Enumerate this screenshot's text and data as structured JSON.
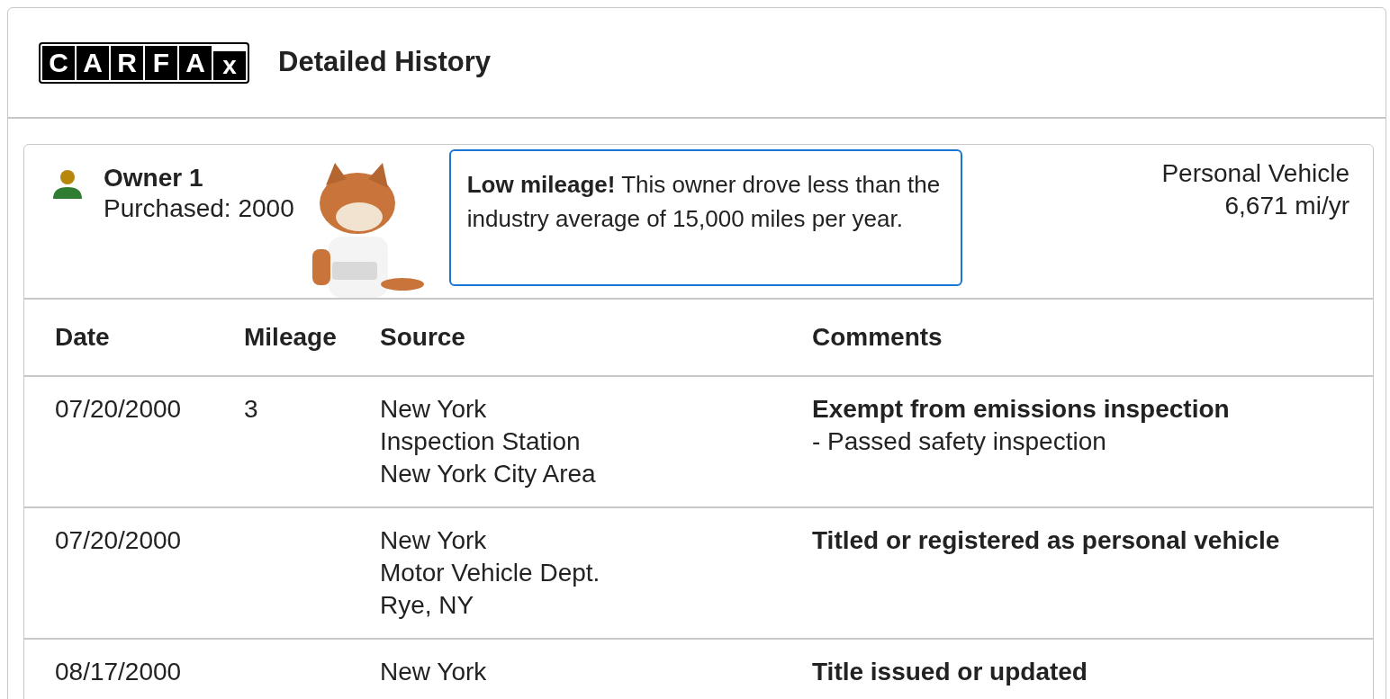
{
  "header": {
    "logo_letters": [
      "C",
      "A",
      "R",
      "F",
      "A",
      "x"
    ],
    "title": "Detailed History"
  },
  "owner": {
    "name": "Owner 1",
    "purchased": "Purchased: 2000",
    "callout": {
      "lead": "Low mileage!",
      "text": "This owner drove less than the industry average of 15,000 miles per year."
    },
    "vehicle_type": "Personal Vehicle",
    "mileage_rate": "6,671 mi/yr"
  },
  "table": {
    "columns": [
      "Date",
      "Mileage",
      "Source",
      "Comments"
    ],
    "rows": [
      {
        "date": "07/20/2000",
        "mileage": "3",
        "source": [
          "New York",
          "Inspection Station",
          "New York City Area"
        ],
        "comments": [
          {
            "kind": "bold",
            "text": "Exempt from emissions inspection"
          },
          {
            "kind": "bullet",
            "text": "- Passed safety inspection"
          }
        ]
      },
      {
        "date": "07/20/2000",
        "source": [
          "New York",
          "Motor Vehicle Dept.",
          "Rye, NY"
        ],
        "comments": [
          {
            "kind": "bold",
            "text": "Titled or registered as personal vehicle"
          }
        ]
      },
      {
        "date": "08/17/2000",
        "source": [
          "New York"
        ],
        "comments": [
          {
            "kind": "bold",
            "text": "Title issued or updated"
          }
        ]
      }
    ]
  }
}
